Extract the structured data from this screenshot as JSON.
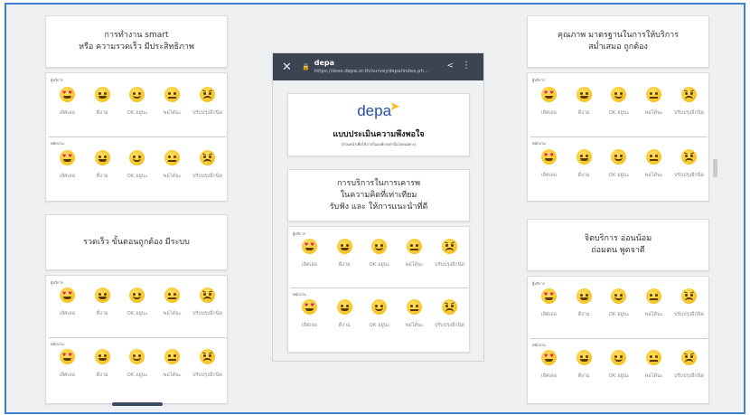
{
  "emoji_options": [
    {
      "label": "เลิศเลอ",
      "icon": "heart-eyes-icon"
    },
    {
      "label": "ดีงาม",
      "icon": "grin-icon"
    },
    {
      "label": "OK อยู่นะ",
      "icon": "smile-icon"
    },
    {
      "label": "พอได้นะ",
      "icon": "neutral-icon"
    },
    {
      "label": "ปรับปรุงอีกนิด",
      "icon": "frown-icon"
    }
  ],
  "sections": {
    "service": "ผู้บริการ",
    "staff": "พนักงาน"
  },
  "cards": {
    "top_left": {
      "line1": "การทำงาน smart",
      "line2": "หรือ ความรวดเร็ว มีประสิทธิภาพ"
    },
    "bottom_left": {
      "line1": "รวดเร็ว ขั้นตอนถูกต้อง มีระบบ",
      "line2": ""
    },
    "top_right": {
      "line1": "คุณภาพ มาตรฐานในการให้บริการ",
      "line2": "สม่ำเสมอ ถูกต้อง"
    },
    "bottom_right": {
      "line1": "จิตบริการ อ่อนน้อม",
      "line2": "ถ่อมตน พูดจาดี"
    },
    "center": {
      "line1": "การบริการในการเคารพ",
      "line2": "ในความคิดที่เท่าเทียม",
      "line3": "รับฟัง และ ให้การแนะนำที่ดี"
    }
  },
  "browser": {
    "title": "depa",
    "url": "https://dsss.depa.or.th/surveydepa/index.ph..."
  },
  "survey_header": {
    "logo": "depa",
    "title": "แบบประเมินความพึงพอใจ",
    "subtitle": "(ส่วนหน้าเพื่อใช้ภายในองค์กรเท่านั้นโดยเฉพาะ)"
  },
  "colors": {
    "frame": "#3f7fd0",
    "browser_bar": "#3d4451",
    "logo": "#2a4ea0",
    "emoji": "#f2b705"
  }
}
